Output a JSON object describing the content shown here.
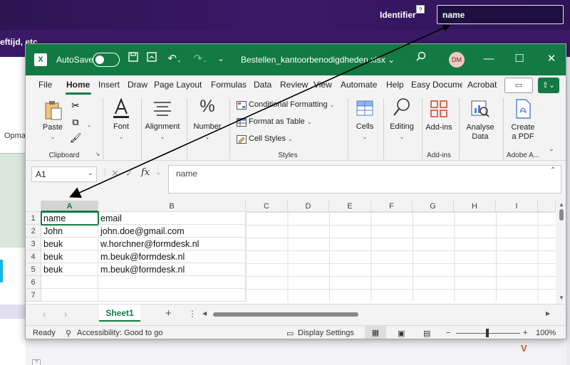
{
  "background": {
    "identifier_label": "Identifier",
    "identifier_value": "name",
    "help_glyph": "?",
    "subtitle": "eftijd, etc",
    "tab_label": "Opma",
    "logo_glyph": "V"
  },
  "window": {
    "autosave_label": "AutoSave",
    "title": "Bestellen_kantoorbenodigdheden.xlsx",
    "title_caret": "⌄",
    "avatar": "DM"
  },
  "tabs": [
    "File",
    "Home",
    "Insert",
    "Draw",
    "Page Layout",
    "Formulas",
    "Data",
    "Review",
    "View",
    "Automate",
    "Help",
    "Easy Docume",
    "Acrobat"
  ],
  "ribbon": {
    "paste": "Paste",
    "clipboard": "Clipboard",
    "font": "Font",
    "alignment": "Alignment",
    "number": "Number",
    "conditional_formatting": "Conditional Formatting",
    "format_as_table": "Format as Table",
    "cell_styles": "Cell Styles",
    "styles": "Styles",
    "cells": "Cells",
    "editing": "Editing",
    "add_ins": "Add-ins",
    "add_ins_group": "Add-ins",
    "analyse_data_1": "Analyse",
    "analyse_data_2": "Data",
    "create_pdf_1": "Create",
    "create_pdf_2": "a PDF",
    "adobe_group": "Adobe A..."
  },
  "formula_bar": {
    "name_box": "A1",
    "fx": "fx",
    "value": "name"
  },
  "grid": {
    "columns": [
      "A",
      "B",
      "C",
      "D",
      "E",
      "F",
      "G",
      "H",
      "I"
    ],
    "rows": [
      {
        "num": "1",
        "a": "name",
        "b": "email"
      },
      {
        "num": "2",
        "a": "John",
        "b": "john.doe@gmail.com"
      },
      {
        "num": "3",
        "a": "beuk",
        "b": "w.horchner@formdesk.nl"
      },
      {
        "num": "4",
        "a": "beuk",
        "b": "m.beuk@formdesk.nl"
      },
      {
        "num": "5",
        "a": "beuk",
        "b": "m.beuk@formdesk.nl"
      },
      {
        "num": "6",
        "a": "",
        "b": ""
      },
      {
        "num": "7",
        "a": "",
        "b": ""
      }
    ]
  },
  "sheets": {
    "active": "Sheet1",
    "add": "+"
  },
  "status": {
    "ready": "Ready",
    "accessibility": "Accessibility: Good to go",
    "display_settings": "Display Settings",
    "zoom": "100%"
  },
  "colors": {
    "excel_green": "#127a42",
    "purple": "#3b1868"
  }
}
